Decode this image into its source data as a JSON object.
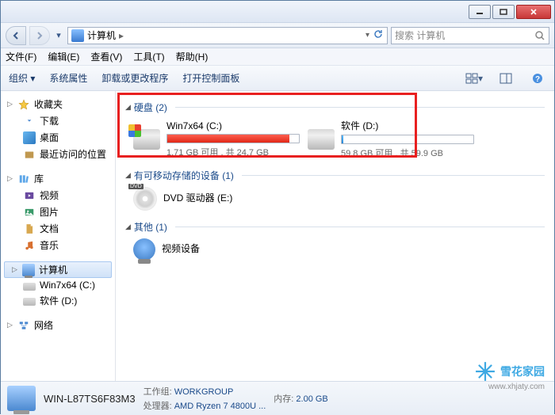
{
  "titlebar": {},
  "address": {
    "location": "计算机",
    "refresh_title": "刷新"
  },
  "search": {
    "placeholder": "搜索 计算机"
  },
  "menubar": {
    "file": "文件(F)",
    "edit": "编辑(E)",
    "view": "查看(V)",
    "tools": "工具(T)",
    "help": "帮助(H)"
  },
  "toolbar": {
    "organize": "组织 ▾",
    "system_props": "系统属性",
    "uninstall": "卸载或更改程序",
    "control_panel": "打开控制面板"
  },
  "sidebar": {
    "favorites": {
      "label": "收藏夹",
      "items": [
        {
          "label": "下载"
        },
        {
          "label": "桌面"
        },
        {
          "label": "最近访问的位置"
        }
      ]
    },
    "libraries": {
      "label": "库",
      "items": [
        {
          "label": "视频"
        },
        {
          "label": "图片"
        },
        {
          "label": "文档"
        },
        {
          "label": "音乐"
        }
      ]
    },
    "computer": {
      "label": "计算机",
      "items": [
        {
          "label": "Win7x64 (C:)"
        },
        {
          "label": "软件 (D:)"
        }
      ]
    },
    "network": {
      "label": "网络"
    }
  },
  "content": {
    "groups": {
      "hdd": {
        "label": "硬盘 (2)",
        "items": [
          {
            "name": "Win7x64 (C:)",
            "stat": "1.71 GB 可用 , 共 24.7 GB",
            "fill_pct": 93,
            "fill_color": "red"
          },
          {
            "name": "软件 (D:)",
            "stat": "59.8 GB 可用 , 共 59.9 GB",
            "fill_pct": 1,
            "fill_color": "blue"
          }
        ]
      },
      "removable": {
        "label": "有可移动存储的设备 (1)",
        "items": [
          {
            "name": "DVD 驱动器 (E:)"
          }
        ]
      },
      "other": {
        "label": "其他 (1)",
        "items": [
          {
            "name": "视频设备"
          }
        ]
      }
    }
  },
  "details": {
    "hostname": "WIN-L87TS6F83M3",
    "workgroup_label": "工作组:",
    "workgroup": "WORKGROUP",
    "memory_label": "内存:",
    "memory": "2.00 GB",
    "cpu_label": "处理器:",
    "cpu": "AMD Ryzen 7 4800U ..."
  },
  "watermark": {
    "text": "雪花家园",
    "url": "www.xhjaty.com"
  },
  "chart_data": {
    "type": "bar",
    "title": "Disk usage",
    "series": [
      {
        "name": "Win7x64 (C:)",
        "used_gb": 22.99,
        "total_gb": 24.7,
        "free_gb": 1.71
      },
      {
        "name": "软件 (D:)",
        "used_gb": 0.1,
        "total_gb": 59.9,
        "free_gb": 59.8
      }
    ]
  }
}
